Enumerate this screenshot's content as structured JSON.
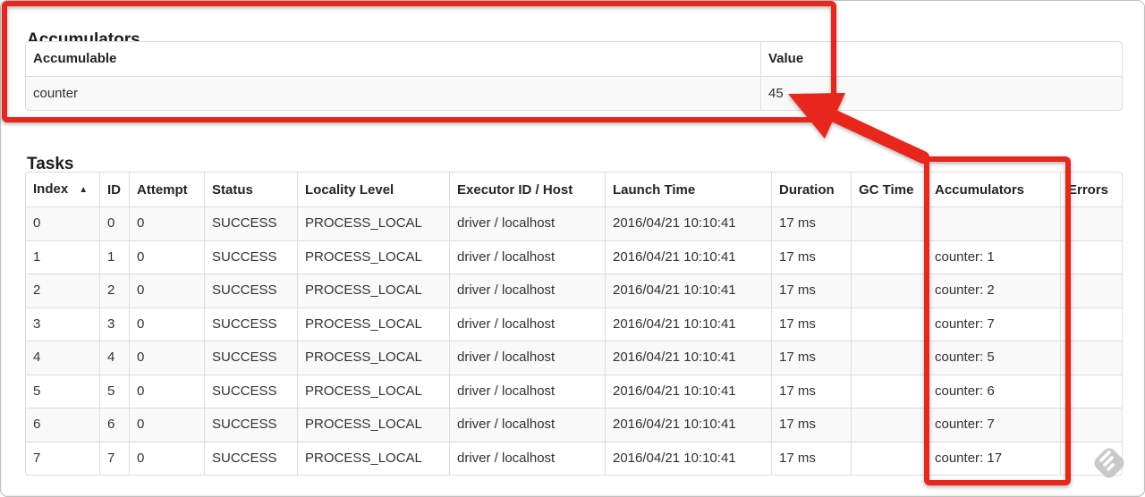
{
  "accumulators_section": {
    "heading": "Accumulators",
    "columns": [
      "Accumulable",
      "Value"
    ],
    "rows": [
      [
        "counter",
        "45"
      ]
    ]
  },
  "tasks_section": {
    "heading": "Tasks",
    "sort_icon": "▲",
    "sorted_column": "Index",
    "columns": [
      "Index",
      "ID",
      "Attempt",
      "Status",
      "Locality Level",
      "Executor ID / Host",
      "Launch Time",
      "Duration",
      "GC Time",
      "Accumulators",
      "Errors"
    ],
    "rows": [
      [
        "0",
        "0",
        "0",
        "SUCCESS",
        "PROCESS_LOCAL",
        "driver / localhost",
        "2016/04/21 10:10:41",
        "17 ms",
        "",
        "",
        ""
      ],
      [
        "1",
        "1",
        "0",
        "SUCCESS",
        "PROCESS_LOCAL",
        "driver / localhost",
        "2016/04/21 10:10:41",
        "17 ms",
        "",
        "counter: 1",
        ""
      ],
      [
        "2",
        "2",
        "0",
        "SUCCESS",
        "PROCESS_LOCAL",
        "driver / localhost",
        "2016/04/21 10:10:41",
        "17 ms",
        "",
        "counter: 2",
        ""
      ],
      [
        "3",
        "3",
        "0",
        "SUCCESS",
        "PROCESS_LOCAL",
        "driver / localhost",
        "2016/04/21 10:10:41",
        "17 ms",
        "",
        "counter: 7",
        ""
      ],
      [
        "4",
        "4",
        "0",
        "SUCCESS",
        "PROCESS_LOCAL",
        "driver / localhost",
        "2016/04/21 10:10:41",
        "17 ms",
        "",
        "counter: 5",
        ""
      ],
      [
        "5",
        "5",
        "0",
        "SUCCESS",
        "PROCESS_LOCAL",
        "driver / localhost",
        "2016/04/21 10:10:41",
        "17 ms",
        "",
        "counter: 6",
        ""
      ],
      [
        "6",
        "6",
        "0",
        "SUCCESS",
        "PROCESS_LOCAL",
        "driver / localhost",
        "2016/04/21 10:10:41",
        "17 ms",
        "",
        "counter: 7",
        ""
      ],
      [
        "7",
        "7",
        "0",
        "SUCCESS",
        "PROCESS_LOCAL",
        "driver / localhost",
        "2016/04/21 10:10:41",
        "17 ms",
        "",
        "counter: 17",
        ""
      ]
    ]
  },
  "annotations": {
    "color": "#e8281a",
    "boxes": [
      "accumulators-summary-box",
      "accumulators-column-box"
    ],
    "arrow_points_to": "45"
  },
  "watermark": {
    "icon": "feedly-logo-icon",
    "color": "#c9c9c9"
  }
}
